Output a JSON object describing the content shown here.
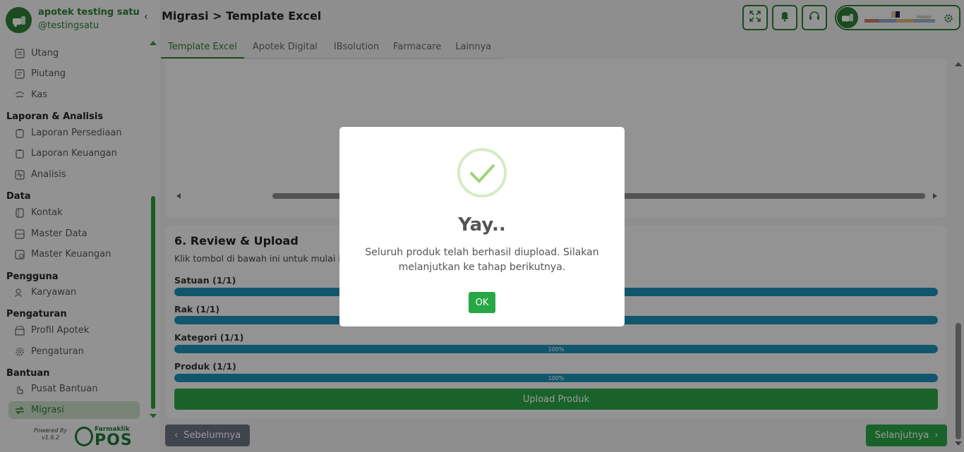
{
  "brand": {
    "name": "apotek testing satu",
    "handle": "@testingsatu"
  },
  "header": {
    "title": "Migrasi > Template Excel"
  },
  "sidebar": {
    "items_top": [
      {
        "label": "Utang",
        "icon": "ledger-icon"
      },
      {
        "label": "Piutang",
        "icon": "receivable-icon"
      },
      {
        "label": "Kas",
        "icon": "cash-icon"
      }
    ],
    "sections": [
      {
        "title": "Laporan & Analisis",
        "items": [
          {
            "label": "Laporan Persediaan"
          },
          {
            "label": "Laporan Keuangan"
          },
          {
            "label": "Analisis"
          }
        ]
      },
      {
        "title": "Data",
        "items": [
          {
            "label": "Kontak"
          },
          {
            "label": "Master Data"
          },
          {
            "label": "Master Keuangan"
          }
        ]
      },
      {
        "title": "Pengguna",
        "items": [
          {
            "label": "Karyawan"
          }
        ]
      },
      {
        "title": "Pengaturan",
        "items": [
          {
            "label": "Profil Apotek"
          },
          {
            "label": "Pengaturan"
          }
        ]
      },
      {
        "title": "Bantuan",
        "items": [
          {
            "label": "Pusat Bantuan"
          },
          {
            "label": "Migrasi",
            "active": true
          }
        ]
      }
    ],
    "powered_by": "Powered By",
    "version": "v1.6.2",
    "footer_logo_small": "Farmaklik",
    "footer_logo_big": "POS"
  },
  "tabs": [
    {
      "label": "Template Excel",
      "active": true
    },
    {
      "label": "Apotek Digital"
    },
    {
      "label": "IBsolution"
    },
    {
      "label": "Farmacare"
    },
    {
      "label": "Lainnya"
    }
  ],
  "review": {
    "title": "6. Review & Upload",
    "description": "Klik tombol di bawah ini untuk mulai i",
    "progress": [
      {
        "label": "Satuan (1/1)",
        "percent": 100,
        "text": ""
      },
      {
        "label": "Rak (1/1)",
        "percent": 100,
        "text": ""
      },
      {
        "label": "Kategori (1/1)",
        "percent": 100,
        "text": "100%"
      },
      {
        "label": "Produk (1/1)",
        "percent": 100,
        "text": "100%"
      }
    ],
    "upload_label": "Upload Produk"
  },
  "nav_buttons": {
    "prev": "Sebelumnya",
    "next": "Selanjutnya"
  },
  "modal": {
    "title": "Yay..",
    "message": "Seluruh produk telah berhasil diupload. Silakan melanjutkan ke tahap berikutnya.",
    "ok": "OK"
  },
  "colors": {
    "primary": "#2e7d32",
    "accent": "#2aa547",
    "progress": "#1d8fb5"
  }
}
